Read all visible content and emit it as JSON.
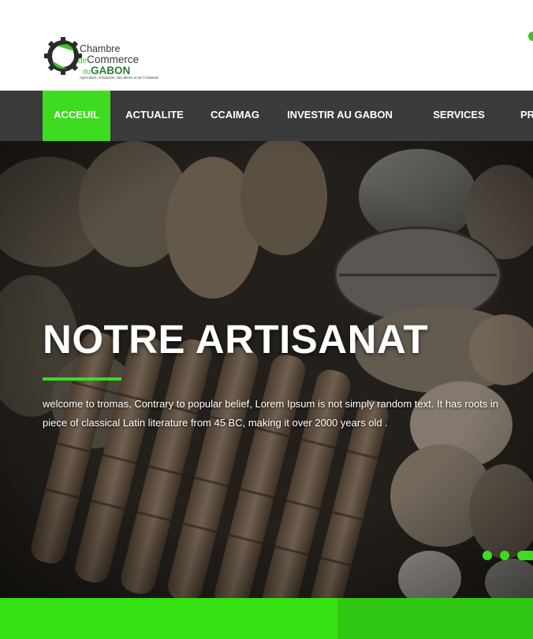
{
  "header": {
    "logo": {
      "line1": "Chambre",
      "line2_prefix": "de",
      "line2": "Commerce",
      "line3_prefix": "du",
      "line3": "GABON",
      "tagline": "Agriculture, d'Industrie, des Mines et de l'Artisanat"
    }
  },
  "nav": {
    "items": [
      {
        "label": "ACCEUIL",
        "active": true
      },
      {
        "label": "ACTUALITE",
        "active": false
      },
      {
        "label": "CCAIMAG",
        "active": false
      },
      {
        "label": "INVESTIR AU GABON",
        "active": false
      },
      {
        "label": "SERVICES",
        "active": false
      },
      {
        "label": "PR",
        "active": false
      }
    ]
  },
  "hero": {
    "title": "NOTRE ARTISANAT",
    "desc_line1": "welcome to tromas, Contrary to popular belief, Lorem Ipsum is not simply random text. It has roots in",
    "desc_line2": "piece of classical Latin literature from 45 BC, making it over 2000 years old .",
    "slider_dots": 3
  },
  "colors": {
    "accent": "#3ddc20",
    "nav_bg": "#3b3b3b",
    "bottom_left": "#35e013",
    "bottom_right": "#2fc714"
  }
}
